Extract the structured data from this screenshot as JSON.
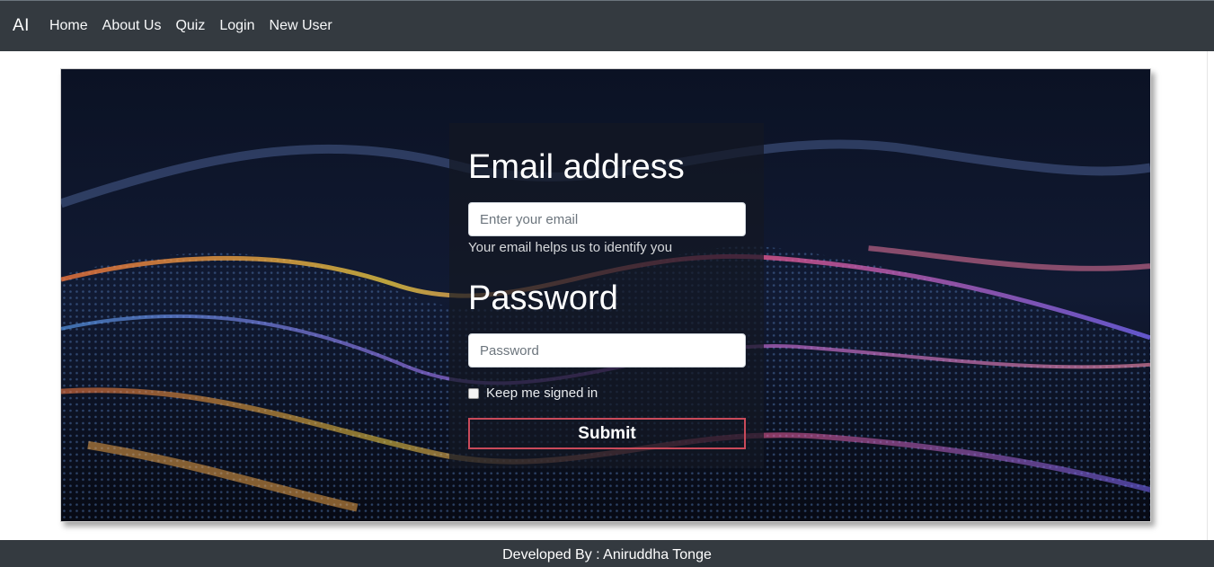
{
  "navbar": {
    "brand": "AI",
    "links": [
      "Home",
      "About Us",
      "Quiz",
      "Login",
      "New User"
    ]
  },
  "form": {
    "email_title": "Email address",
    "email_placeholder": "Enter your email",
    "email_help": "Your email helps us to identify you",
    "password_title": "Password",
    "password_placeholder": "Password",
    "keep_signed_in": "Keep me signed in",
    "submit_label": "Submit"
  },
  "footer": {
    "text": "Developed By : Aniruddha Tonge"
  },
  "colors": {
    "navbar_bg": "#343a40",
    "submit_border": "#c94a5a"
  }
}
